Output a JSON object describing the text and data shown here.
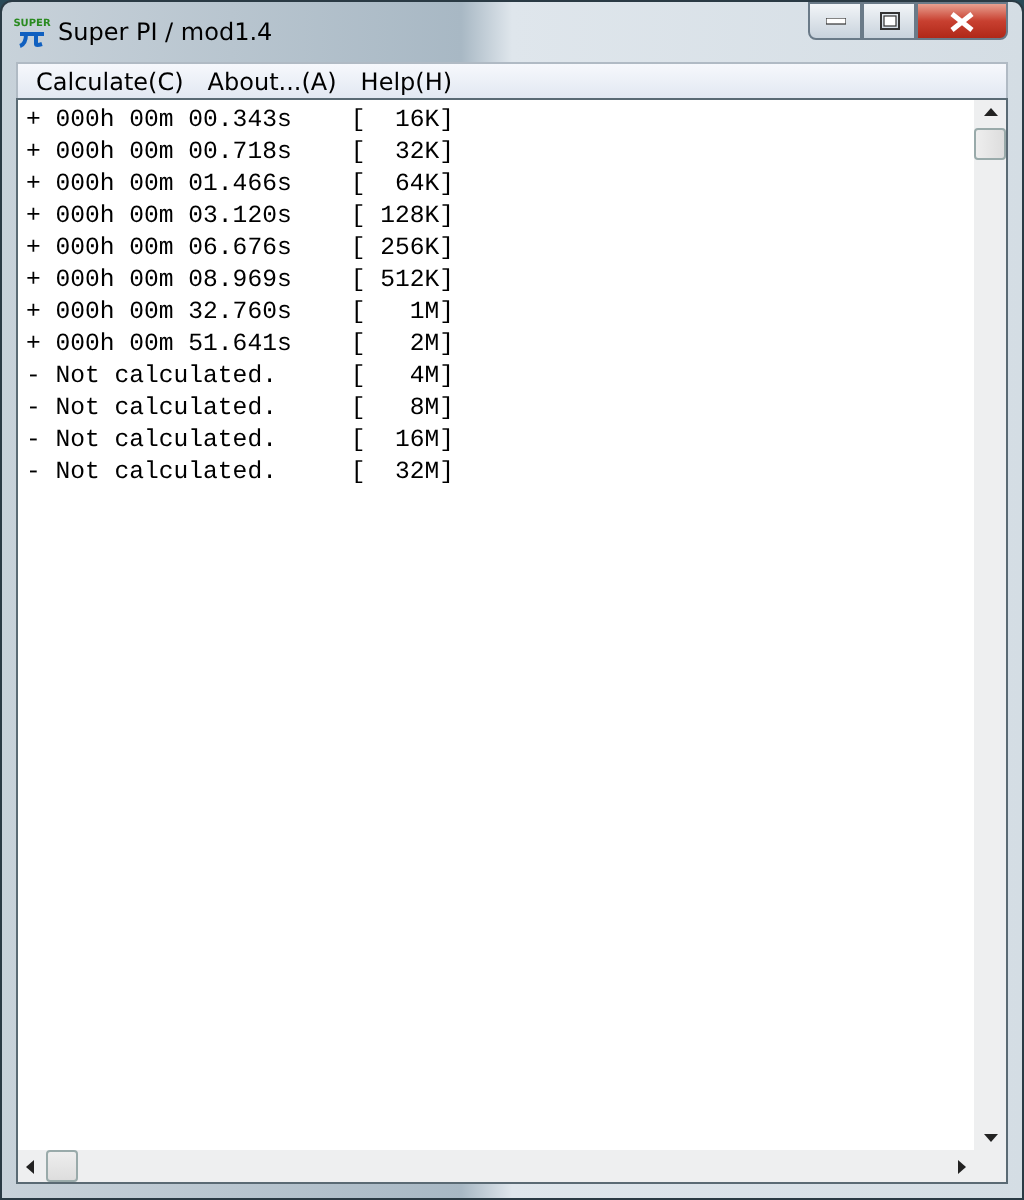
{
  "window": {
    "title": "Super PI / mod1.4",
    "icon_text": "SUPER"
  },
  "menu": [
    "Calculate(C)",
    "About...(A)",
    "Help(H)"
  ],
  "lines": [
    "+ 000h 00m 00.343s    [  16K]",
    "+ 000h 00m 00.718s    [  32K]",
    "+ 000h 00m 01.466s    [  64K]",
    "+ 000h 00m 03.120s    [ 128K]",
    "+ 000h 00m 06.676s    [ 256K]",
    "+ 000h 00m 08.969s    [ 512K]",
    "+ 000h 00m 32.760s    [   1M]",
    "+ 000h 00m 51.641s    [   2M]",
    "- Not calculated.     [   4M]",
    "- Not calculated.     [   8M]",
    "- Not calculated.     [  16M]",
    "- Not calculated.     [  32M]"
  ]
}
